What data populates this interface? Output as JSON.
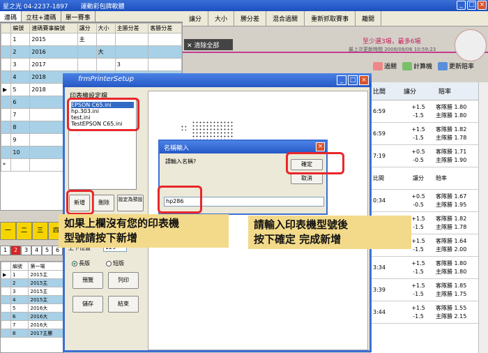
{
  "app": {
    "title": "星之光 04-2237-1897",
    "subtitle": "運動彩包牌軟體"
  },
  "left_tabs": [
    "連碼",
    "立柱+連碼",
    "單一賽事"
  ],
  "grid1": {
    "headers": [
      "",
      "編號",
      "連碼賽事編號",
      "讓分",
      "大小",
      "主勝分差",
      "客勝分差"
    ],
    "rows": [
      [
        "",
        "1",
        "2015",
        "主",
        "",
        "",
        ""
      ],
      [
        "",
        "2",
        "2016",
        "",
        "大",
        "",
        ""
      ],
      [
        "",
        "3",
        "2017",
        "",
        "",
        "3",
        ""
      ],
      [
        "",
        "4",
        "2018",
        "",
        "",
        "",
        ""
      ],
      [
        "▶",
        "5",
        "2018",
        "",
        "",
        "",
        ""
      ],
      [
        "",
        "6",
        "",
        "",
        "",
        "",
        ""
      ],
      [
        "",
        "7",
        "",
        "",
        "",
        "",
        ""
      ],
      [
        "",
        "8",
        "",
        "",
        "",
        "",
        ""
      ],
      [
        "",
        "9",
        "",
        "",
        "",
        "",
        ""
      ],
      [
        "",
        "10",
        "",
        "",
        "",
        "",
        ""
      ],
      [
        "*",
        "",
        "",
        "",
        "",
        "",
        ""
      ]
    ]
  },
  "top_menu": [
    "讓分",
    "大小",
    "勝分差",
    "混合過關",
    "重新抓取賽事",
    "離開"
  ],
  "clear_all": "清除全部",
  "promo": {
    "line1": "至少選3場，最多6場",
    "line2": "最上次更新時間 2008/08/06 10:59:23"
  },
  "toolbar_right": [
    "過關",
    "計算機",
    "更新賠率"
  ],
  "right_grid": {
    "headers": [
      "比間",
      "讓分",
      "賠率"
    ],
    "rows": [
      {
        "t": "6:59",
        "r": [
          "+1.5",
          "-1.5"
        ],
        "o": [
          "客隊勝 1.80",
          "主隊勝 1.80"
        ]
      },
      {
        "t": "6:59",
        "r": [
          "+1.5",
          "-1.5"
        ],
        "o": [
          "客隊勝 1.82",
          "主隊勝 1.78"
        ]
      },
      {
        "t": "7:19",
        "r": [
          "+0.5",
          "-0.5"
        ],
        "o": [
          "客隊勝 1.71",
          "主隊勝 1.90"
        ]
      },
      {
        "t": "比間",
        "r": [
          "讓分",
          ""
        ],
        "o": [
          "賠率",
          ""
        ]
      },
      {
        "t": "0:34",
        "r": [
          "+0.5",
          "-0.5"
        ],
        "o": [
          "客隊勝 1.67",
          "主隊勝 1.95"
        ]
      },
      {
        "t": "0:34",
        "r": [
          "+1.5",
          "-1.5"
        ],
        "o": [
          "客隊勝 1.82",
          "主隊勝 1.78"
        ]
      },
      {
        "t": "2:19",
        "r": [
          "+1.5",
          "-1.5"
        ],
        "o": [
          "客隊勝 1.64",
          "主隊勝 2.00"
        ]
      },
      {
        "t": "3:34",
        "r": [
          "+1.5",
          "-1.5"
        ],
        "o": [
          "客隊勝 1.80",
          "主隊勝 1.80"
        ]
      },
      {
        "t": "3:39",
        "r": [
          "+1.5",
          "-1.5"
        ],
        "o": [
          "客隊勝 1.85",
          "主隊勝 1.75"
        ]
      },
      {
        "t": "3:44",
        "r": [
          "+1.5",
          "-1.5"
        ],
        "o": [
          "客隊勝 1.55",
          "主隊勝 2.15"
        ]
      }
    ]
  },
  "printer_dialog": {
    "title": "frmPrinterSetup",
    "group": "印表機設定檔",
    "files": [
      "EPSON C65.ini",
      "hp.303.ini",
      "test.ini",
      "TestEPSON C65.ini"
    ],
    "add": "新增",
    "delete": "刪除",
    "set_default": "設定為預設",
    "top_margin_label": "上下位置",
    "top_margin_value": "129",
    "landscape": "長版",
    "portrait": "短版",
    "preview": "預覽",
    "print": "列印",
    "save": "儲存",
    "close": "結束"
  },
  "name_dialog": {
    "title": "名稱輸入",
    "prompt": "請輸入名稱?",
    "ok": "確定",
    "cancel": "取消",
    "value": "hp286"
  },
  "callout_left": {
    "line1": "如果上欄沒有您的印表機",
    "line2": "型號請按下新增"
  },
  "callout_right": {
    "line1": "請輸入印表機型號後",
    "line2": "按下確定 完成新增"
  },
  "yellow_buttons": [
    "一",
    "二",
    "三",
    "四"
  ],
  "pager": [
    "1",
    "2",
    "3",
    "4",
    "5",
    "6"
  ],
  "grid2": {
    "headers": [
      "",
      "編號",
      "第一場"
    ],
    "rows": [
      [
        "▶",
        "1",
        "2015主"
      ],
      [
        "",
        "2",
        "2015主"
      ],
      [
        "",
        "3",
        "2015主"
      ],
      [
        "",
        "4",
        "2015主"
      ],
      [
        "",
        "5",
        "2016大"
      ],
      [
        "",
        "6",
        "2016大"
      ],
      [
        "",
        "7",
        "2016大"
      ],
      [
        "",
        "8",
        "2017主勝"
      ]
    ]
  }
}
